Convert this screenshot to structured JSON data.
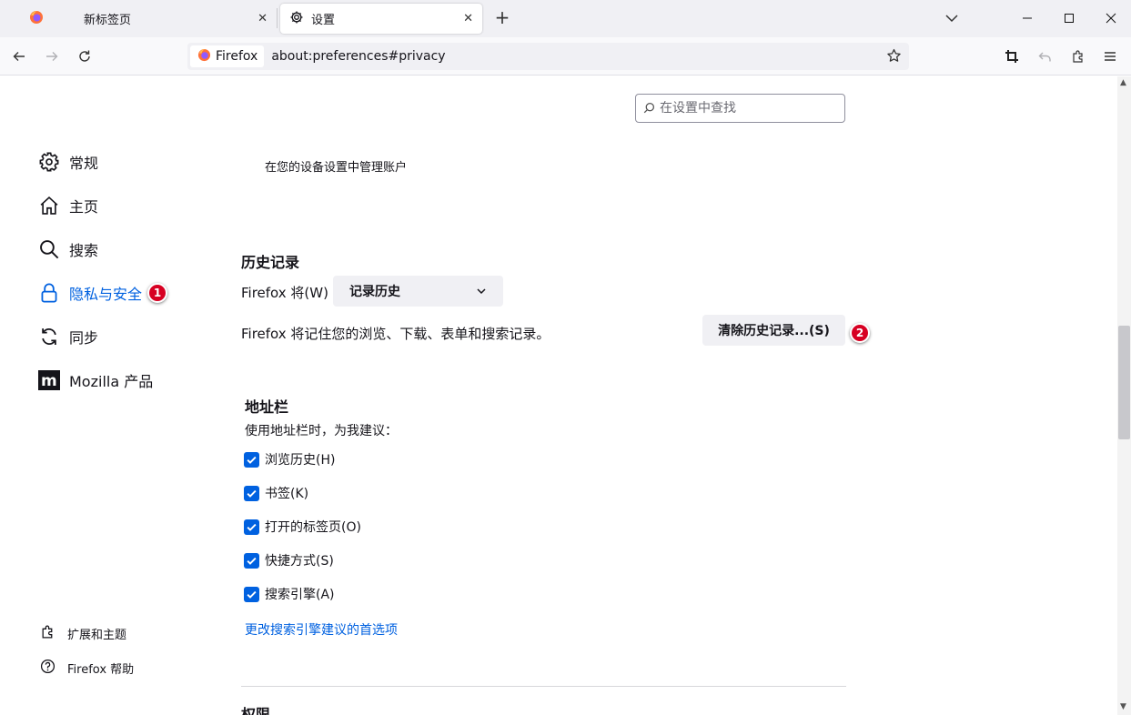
{
  "tabs": [
    {
      "title": "",
      "icon": "firefox-icon"
    },
    {
      "title": "新标签页",
      "close": "✕"
    },
    {
      "title": "设置",
      "icon": "gear-icon",
      "close": "✕",
      "active": true
    }
  ],
  "tabstrip": {
    "new_tab": "+"
  },
  "navbar": {
    "identity_label": "Firefox",
    "url": "about:preferences#privacy"
  },
  "search": {
    "placeholder": "在设置中查找"
  },
  "categories": [
    {
      "label": "常规",
      "icon": "gear-icon"
    },
    {
      "label": "主页",
      "icon": "home-icon"
    },
    {
      "label": "搜索",
      "icon": "search-icon"
    },
    {
      "label": "隐私与安全",
      "icon": "lock-icon",
      "selected": true,
      "badge": "1"
    },
    {
      "label": "同步",
      "icon": "sync-icon"
    },
    {
      "label": "Mozilla 产品",
      "icon": "mozilla-icon"
    }
  ],
  "bottom_links": [
    {
      "label": "扩展和主题",
      "icon": "puzzle-icon"
    },
    {
      "label": "Firefox 帮助",
      "icon": "help-icon"
    }
  ],
  "account_note": "在您的设备设置中管理账户",
  "history": {
    "heading": "历史记录",
    "mode_label": "Firefox 将(W)",
    "mode_value": "记录历史",
    "description": "Firefox 将记住您的浏览、下载、表单和搜索记录。",
    "clear_button": "清除历史记录...(S)",
    "badge": "2"
  },
  "address_bar": {
    "heading": "地址栏",
    "intro": "使用地址栏时，为我建议：",
    "options": [
      {
        "label": "浏览历史(H)",
        "checked": true
      },
      {
        "label": "书签(K)",
        "checked": true
      },
      {
        "label": "打开的标签页(O)",
        "checked": true
      },
      {
        "label": "快捷方式(S)",
        "checked": true
      },
      {
        "label": "搜索引擎(A)",
        "checked": true
      }
    ],
    "link": "更改搜索引擎建议的首选项"
  },
  "next_section_heading": "权限",
  "colors": {
    "accent": "#0061e0",
    "badge": "#d70022",
    "tabstrip": "#f0f0f4"
  }
}
